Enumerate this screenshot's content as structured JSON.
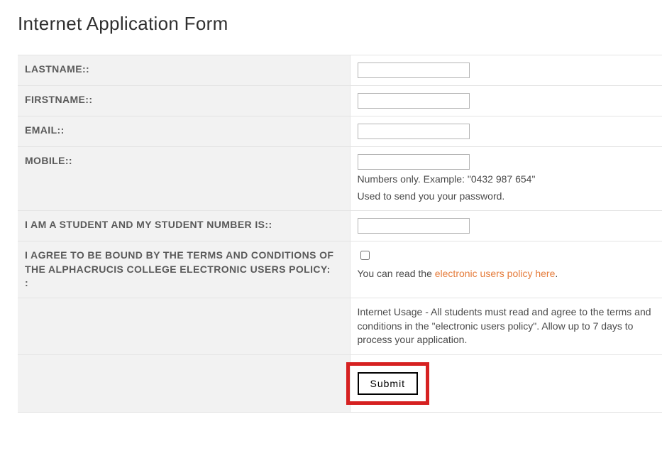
{
  "title": "Internet Application Form",
  "rows": {
    "lastname": {
      "label": "LASTNAME:",
      "value": ""
    },
    "firstname": {
      "label": "FIRSTNAME:",
      "value": ""
    },
    "email": {
      "label": "EMAIL:",
      "value": ""
    },
    "mobile": {
      "label": "MOBILE:",
      "value": "",
      "hint1": "Numbers only. Example: \"0432 987 654\"",
      "hint2": "Used to send you your password."
    },
    "student": {
      "label": "I AM A STUDENT AND MY STUDENT NUMBER IS:",
      "value": ""
    },
    "agree": {
      "label": "I AGREE TO BE BOUND BY THE TERMS AND CONDITIONS OF THE ALPHACRUCIS COLLEGE ELECTRONIC USERS POLICY:",
      "pretext": "You can read the ",
      "linktext": "electronic users policy here",
      "posttext": "."
    },
    "usage": {
      "text": "Internet Usage - All students must read and agree to the terms and conditions in the \"electronic users policy\". Allow up to 7 days to process your application."
    },
    "submit": {
      "label": "Submit"
    }
  }
}
